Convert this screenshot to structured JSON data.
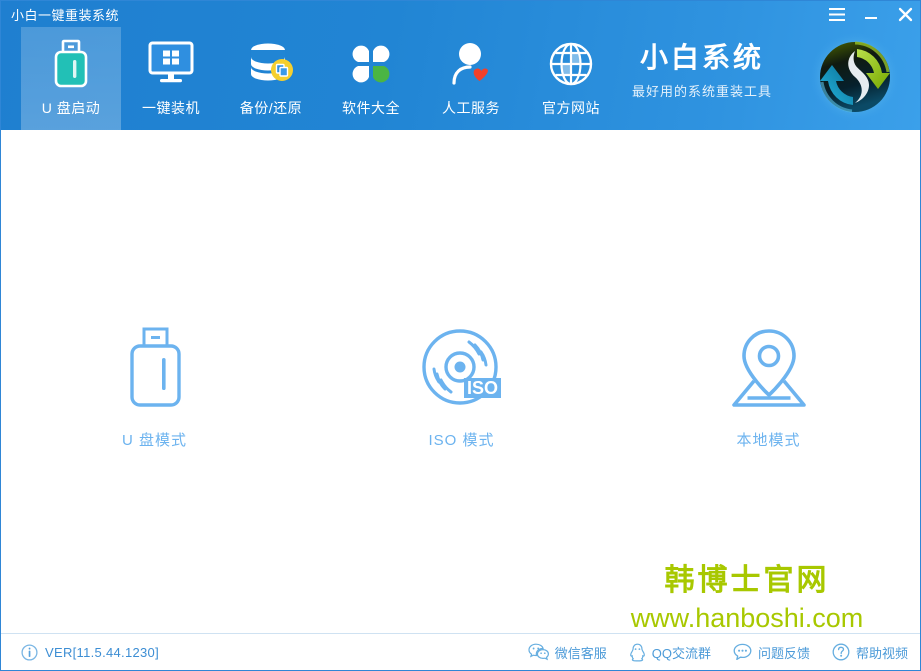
{
  "window": {
    "title": "小白一键重装系统",
    "controls": [
      {
        "name": "menu-button",
        "icon": "hamburger-icon"
      },
      {
        "name": "minimize-button",
        "icon": "minimize-icon"
      },
      {
        "name": "close-button",
        "icon": "close-icon"
      }
    ]
  },
  "accent": {
    "header_blue": "#2185d4",
    "header_blue_light": "#3ba0ea",
    "mode_icon_blue": "#6cb3ef",
    "footer_link_blue": "#4b9ad8",
    "watermark_green": "#a8c800",
    "usb_teal": "#22c0b6",
    "badge_yellow": "#f5cf2e",
    "heart_red": "#f2402a",
    "clover_green": "#4bb543"
  },
  "nav": {
    "items": [
      {
        "label": "U 盘启动",
        "icon": "usb-drive-icon",
        "active": true
      },
      {
        "label": "一键装机",
        "icon": "monitor-windows-icon",
        "active": false
      },
      {
        "label": "备份/还原",
        "icon": "database-backup-icon",
        "active": false
      },
      {
        "label": "软件大全",
        "icon": "clover-apps-icon",
        "active": false
      },
      {
        "label": "人工服务",
        "icon": "person-heart-icon",
        "active": false
      },
      {
        "label": "官方网站",
        "icon": "globe-icon",
        "active": false
      }
    ]
  },
  "brand": {
    "name": "小白系统",
    "tagline": "最好用的系统重装工具",
    "logo_icon": "refresh-cycle-logo-icon"
  },
  "main": {
    "modes": [
      {
        "label": "U 盘模式",
        "icon": "usb-mode-icon"
      },
      {
        "label": "ISO 模式",
        "icon": "iso-disc-icon"
      },
      {
        "label": "本地模式",
        "icon": "map-pin-local-icon"
      }
    ]
  },
  "watermark": {
    "cn": "韩博士官网",
    "url": "www.hanboshi.com"
  },
  "footer": {
    "version": "VER[11.5.44.1230]",
    "version_icon": "info-icon",
    "links": [
      {
        "label": "微信客服",
        "icon": "wechat-icon"
      },
      {
        "label": "QQ交流群",
        "icon": "qq-penguin-icon"
      },
      {
        "label": "问题反馈",
        "icon": "speech-bubble-icon"
      },
      {
        "label": "帮助视频",
        "icon": "question-mark-icon"
      }
    ]
  }
}
